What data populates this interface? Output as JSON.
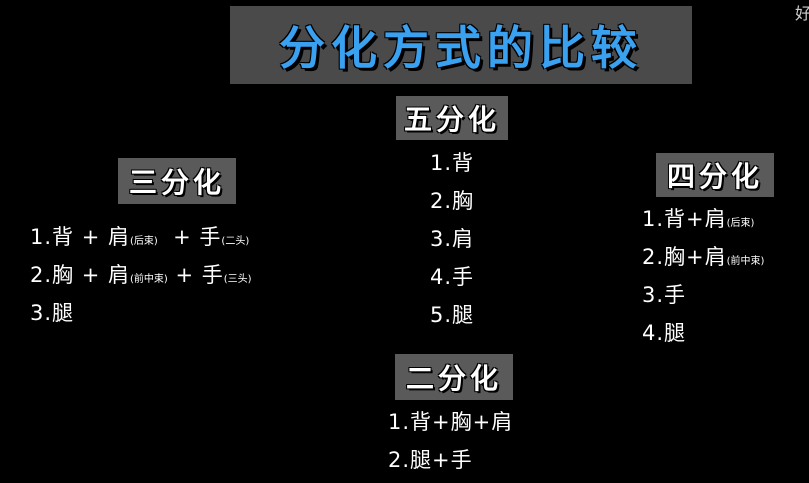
{
  "title": "分化方式的比较",
  "corner_glyph": "好",
  "colors": {
    "background": "#000000",
    "title_box": "#4a4a4a",
    "title_text": "#3aa0f0",
    "label_box": "#5a5a5a",
    "text": "#ffffff"
  },
  "san_fen_hua": {
    "label": "三分化",
    "items": [
      {
        "main": "1.背 + 肩",
        "sub1": "(后束)",
        "mid": "  + 手",
        "sub2": "(二头)"
      },
      {
        "main": "2.胸 + 肩",
        "sub1": "(前中束)",
        "mid": " + 手",
        "sub2": "(三头)"
      },
      {
        "main": "3.腿",
        "sub1": "",
        "mid": "",
        "sub2": ""
      }
    ]
  },
  "wu_fen_hua": {
    "label": "五分化",
    "items": [
      "1.背",
      "2.胸",
      "3.肩",
      "4.手",
      "5.腿"
    ]
  },
  "si_fen_hua": {
    "label": "四分化",
    "items": [
      {
        "main": "1.背+肩",
        "sub": "(后束)"
      },
      {
        "main": "2.胸+肩",
        "sub": "(前中束)"
      },
      {
        "main": "3.手",
        "sub": ""
      },
      {
        "main": "4.腿",
        "sub": ""
      }
    ]
  },
  "er_fen_hua": {
    "label": "二分化",
    "items": [
      "1.背+胸+肩",
      "2.腿+手"
    ]
  }
}
